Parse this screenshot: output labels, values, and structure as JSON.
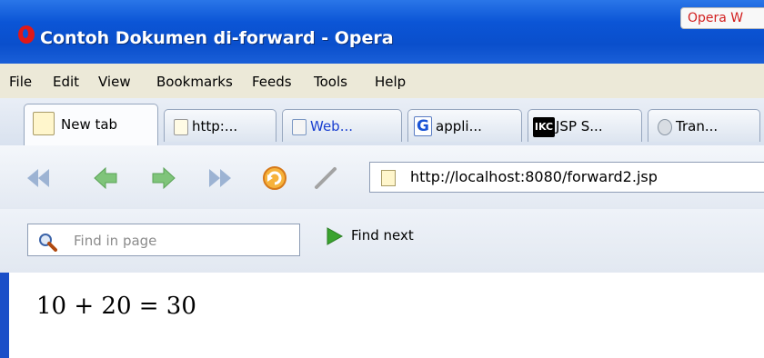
{
  "window": {
    "title": "Contoh Dokumen di-forward - Opera",
    "tooltip": "Opera W"
  },
  "menu": {
    "items": [
      "File",
      "Edit",
      "View",
      "Bookmarks",
      "Feeds",
      "Tools",
      "Help"
    ]
  },
  "tabs": [
    {
      "label": "New tab",
      "icon": "new-tab-icon"
    },
    {
      "label": "http:...",
      "icon": "page-icon"
    },
    {
      "label": "Web...",
      "icon": "document-icon"
    },
    {
      "label": "appli...",
      "icon": "google-icon",
      "icon_text": "G"
    },
    {
      "label": "JSP S...",
      "icon": "ikc-icon",
      "icon_text": "IKC"
    },
    {
      "label": "Tran...",
      "icon": "satellite-icon"
    }
  ],
  "address": {
    "url": "http://localhost:8080/forward2.jsp"
  },
  "find": {
    "placeholder": "Find in page",
    "next_label": "Find next"
  },
  "content": {
    "text": "10 + 20 = 30"
  },
  "colors": {
    "titlebar": "#0b55d6",
    "opera_red": "#e01818",
    "menubar": "#ece9d8"
  }
}
